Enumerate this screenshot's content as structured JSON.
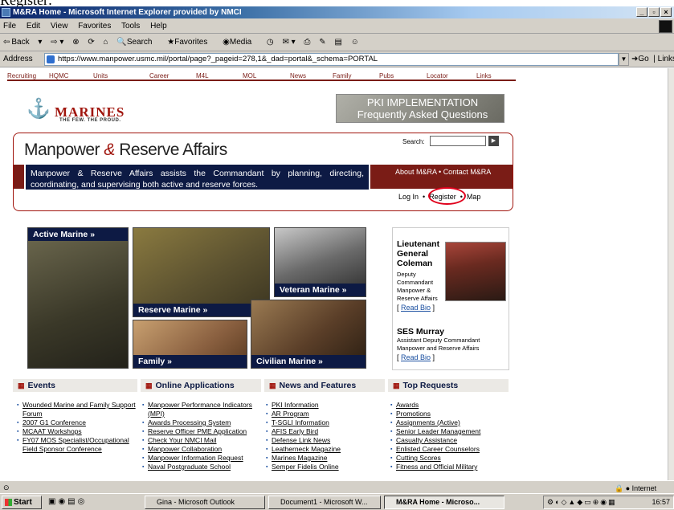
{
  "doc_snippet": "Register:",
  "window": {
    "title": "M&RA Home - Microsoft Internet Explorer provided by NMCI"
  },
  "menu": [
    "File",
    "Edit",
    "View",
    "Favorites",
    "Tools",
    "Help"
  ],
  "toolbar": {
    "back": "Back",
    "search": "Search",
    "favorites": "Favorites",
    "media": "Media"
  },
  "address": {
    "label": "Address",
    "url": "https://www.manpower.usmc.mil/portal/page?_pageid=278,1&_dad=portal&_schema=PORTAL",
    "go": "Go",
    "links": "Links"
  },
  "page": {
    "topnav": [
      "Recruiting",
      "HQMC",
      "Units",
      "Career",
      "M4L",
      "MOL",
      "News",
      "Family",
      "Pubs",
      "Locator",
      "Links"
    ],
    "logo": {
      "title": "MARINES",
      "tagline": "THE FEW. THE PROUD."
    },
    "pki": {
      "line1": "PKI IMPLEMENTATION",
      "line2": "Frequently Asked Questions"
    },
    "site_title": {
      "part1": "Manpower ",
      "amp": "&",
      "part2": " Reserve Affairs"
    },
    "search": {
      "label": "Search:"
    },
    "mission": "Manpower & Reserve Affairs assists the Commandant by planning, directing, coordinating, and supervising both active and reserve forces.",
    "header_links": [
      "About M&RA",
      "Contact M&RA"
    ],
    "account_links": [
      "Log In",
      "Register",
      "Map"
    ],
    "photos": {
      "active": "Active Marine »",
      "reserve": "Reserve Marine »",
      "veteran": "Veteran Marine »",
      "family": "Family »",
      "civilian": "Civilian Marine »"
    },
    "leaders": [
      {
        "name": "Lieutenant General Coleman",
        "title": "Deputy Commandant Manpower & Reserve Affairs",
        "bio": "Read Bio"
      },
      {
        "name": "SES Murray",
        "title": "Assistant Deputy Commandant Manpower and Reserve Affairs",
        "bio": "Read Bio"
      }
    ],
    "columns": [
      {
        "title": "Events",
        "items": [
          "Wounded Marine and Family Support Forum",
          "2007 G1 Conference",
          "MCAAT Workshops",
          "FY07 MOS Specialist/Occupational Field Sponsor Conference"
        ]
      },
      {
        "title": "Online Applications",
        "items": [
          "Manpower Performance Indicators (MPI)",
          "Awards Processing System",
          "Reserve Officer PME Application",
          "Check Your NMCI Mail",
          "Manpower Collaboration",
          "Manpower Information Request",
          "Naval Postgraduate School"
        ]
      },
      {
        "title": "News and Features",
        "items": [
          "PKI Information",
          "AR Program",
          "T-SGLI Information",
          "AFIS Early Bird",
          "Defense Link News",
          "Leatherneck Magazine",
          "Marines Magazine",
          "Semper Fidelis Online"
        ]
      },
      {
        "title": "Top Requests",
        "items": [
          "Awards",
          "Promotions",
          "Assignments (Active)",
          "Senior Leader Management",
          "Casualty Assistance",
          "Enlisted Career Counselors",
          "Cutting Scores",
          "Fitness and Official Military"
        ]
      }
    ]
  },
  "status": {
    "zone": "Internet"
  },
  "taskbar": {
    "start": "Start",
    "tasks": [
      "Gina - Microsoft Outlook",
      "Document1 - Microsoft W...",
      "M&RA Home - Microso..."
    ],
    "clock": "16:57"
  }
}
